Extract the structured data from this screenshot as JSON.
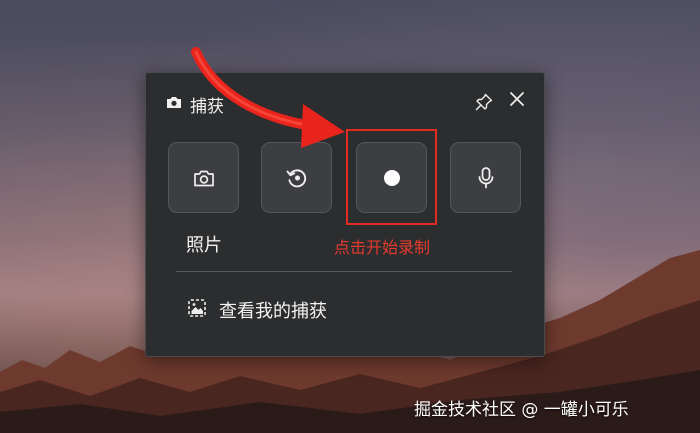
{
  "panel": {
    "title": "捕获",
    "tools": [
      {
        "name": "photo",
        "icon": "camera-icon"
      },
      {
        "name": "rewind",
        "icon": "rewind-icon"
      },
      {
        "name": "record",
        "icon": "record-dot-icon"
      },
      {
        "name": "microphone",
        "icon": "microphone-icon"
      }
    ],
    "photo_label": "照片",
    "view_captures_label": "查看我的捕获"
  },
  "annotation": {
    "hint_text": "点击开始录制",
    "color": "#e02a22"
  },
  "watermark": "掘金技术社区 @ 一罐小可乐"
}
